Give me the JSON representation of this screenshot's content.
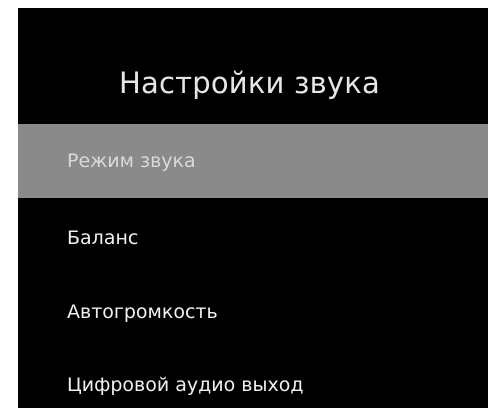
{
  "screen": {
    "title": "Настройки звука"
  },
  "menu": {
    "items": [
      {
        "label": "Режим звука",
        "selected": true
      },
      {
        "label": "Баланс",
        "selected": false
      },
      {
        "label": "Автогромкость",
        "selected": false
      },
      {
        "label": "Цифровой аудио выход",
        "selected": false
      }
    ]
  },
  "colors": {
    "background": "#000000",
    "selected_highlight": "#8a8a8a",
    "text": "#f0f0f0"
  }
}
